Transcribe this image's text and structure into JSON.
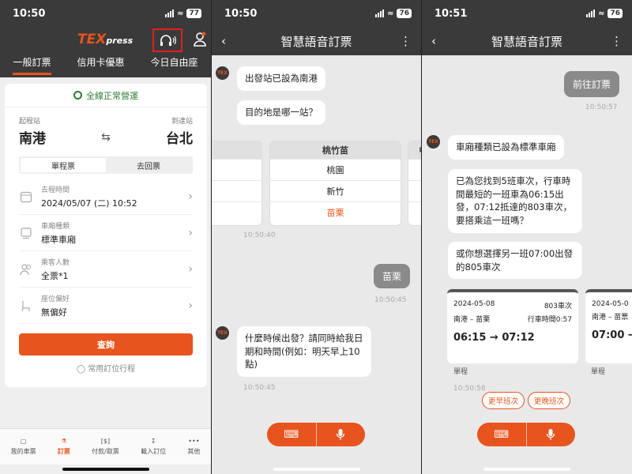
{
  "panel1": {
    "time": "10:50",
    "battery": "77",
    "logo_main": "TEX",
    "logo_sub": "press",
    "tabs": [
      "一般訂票",
      "信用卡優惠",
      "今日自由座"
    ],
    "status_text": "全線正常營運",
    "from_label": "起程站",
    "to_label": "到達站",
    "from_station": "南港",
    "to_station": "台北",
    "trip_types": [
      "單程票",
      "去回票"
    ],
    "rows": [
      {
        "label": "去程時間",
        "value": "2024/05/07 (二) 10:52",
        "icon": "calendar-icon"
      },
      {
        "label": "車廂種類",
        "value": "標準車廂",
        "icon": "train-car-icon"
      },
      {
        "label": "乘客人數",
        "value": "全票*1",
        "icon": "passengers-icon"
      },
      {
        "label": "座位偏好",
        "value": "無偏好",
        "icon": "seat-icon"
      }
    ],
    "query_button": "查詢",
    "favorites_link": "常用訂位行程",
    "bottom_tabs": [
      "我的車票",
      "訂票",
      "付款/取票",
      "載入訂位",
      "其他"
    ]
  },
  "panel2": {
    "time": "10:50",
    "battery": "76",
    "title": "智慧語音訂票",
    "msg1": "出發站已設為南港",
    "msg2": "目的地是哪一站？",
    "picker_header": "桃竹苗",
    "picker_next_header": "中",
    "picker_options": [
      "桃園",
      "新竹",
      "苗栗"
    ],
    "ts1": "10:50:40",
    "user_msg": "苗栗",
    "ts2": "10:50:45",
    "msg3": "什麼時候出發？請同時給我日期和時間(例如：明天早上10點)",
    "ts3": "10:50:45"
  },
  "panel3": {
    "time": "10:51",
    "battery": "76",
    "title": "智慧語音訂票",
    "user_msg": "前往訂票",
    "ts1": "10:50:57",
    "msg1": "車廂種類已設為標準車廂",
    "msg2": "已為您找到5班車次，行車時間最短的一班車為06:15出發，07:12抵達的803車次，要搭乘這一班嗎？",
    "msg3": "或你想選擇另一班07:00出發的805車次",
    "card1": {
      "date": "2024-05-08",
      "train": "803車次",
      "route": "南港 – 苗栗",
      "duration": "行車時間0:57",
      "times": "06:15 → 07:12",
      "type": "單程"
    },
    "card2": {
      "date": "2024-05-0",
      "route": "南港 – 苗票",
      "times": "07:00 →",
      "type": "單程"
    },
    "ts2": "10:50:58",
    "earlier_button": "更早班次",
    "later_button": "更晚班次"
  }
}
